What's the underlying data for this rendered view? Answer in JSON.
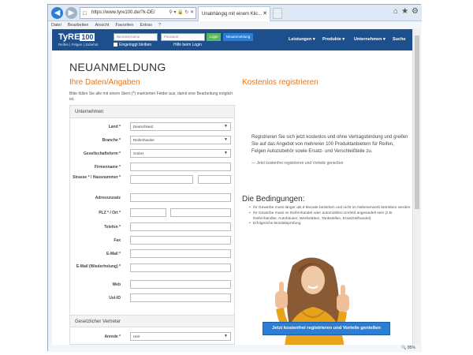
{
  "browser": {
    "url": "https://www.tyre100.de/?k-DE/",
    "tab_title": "Unabhängig mit einem Klic...",
    "menu": [
      "Datei",
      "Bearbeiten",
      "Ansicht",
      "Favoriten",
      "Extras",
      "?"
    ],
    "zoom": "85%"
  },
  "header": {
    "logo": "TyRE",
    "logo_num": "100",
    "tagline": "Reifen | Felgen | Zubehör",
    "user_placeholder": "Benutzername",
    "pass_placeholder": "Passwort",
    "login": "Login",
    "register": "Neuanmeldung",
    "keep_logged": "Eingeloggt bleiben",
    "help": "Hilfe beim Login",
    "nav": [
      "Leistungen ▾",
      "Produkte ▾",
      "Unternehmen ▾",
      "Suche"
    ]
  },
  "page": {
    "title": "NEUANMELDUNG",
    "left_heading": "Ihre Daten/Angaben",
    "right_heading": "Kostenlos registrieren",
    "hint": "Bitte füllen Sie alle mit einem Stern (*) markierten Felder aus, damit eine Bearbeitung möglich ist."
  },
  "form": {
    "section1": "Unternehmen",
    "section2": "Gesetzlicher Vertreter",
    "fields": [
      {
        "label": "Land *",
        "value": "Deutschland"
      },
      {
        "label": "Branche *",
        "value": "Reifenhandel"
      },
      {
        "label": "Gesellschaftsform *",
        "value": "GmbH"
      },
      {
        "label": "Firmenname *",
        "value": ""
      },
      {
        "label": "Strasse * / Hausnummer *",
        "value": ""
      },
      {
        "label": "Adresszusatz",
        "value": ""
      },
      {
        "label": "PLZ * / Ort *",
        "value": ""
      },
      {
        "label": "Telefon *",
        "value": ""
      },
      {
        "label": "Fax",
        "value": ""
      },
      {
        "label": "E-Mail *",
        "value": ""
      },
      {
        "label": "E-Mail (Wiederholung) *",
        "value": ""
      },
      {
        "label": "Web",
        "value": ""
      },
      {
        "label": "Ust-ID",
        "value": ""
      }
    ],
    "anrede_label": "Anrede *",
    "anrede_value": "Herr"
  },
  "right": {
    "text": "Registrieren Sie sich jetzt kostenlos und ohne Vertragsbindung und greifen Sie auf das Angebot von mehreren 100 Produktanbietern für Reifen, Felgen Autozubehör sowie Ersatz- und Verschleißteile zu.",
    "subtext": "— Jetzt kostenfrei registrieren und Vorteile genießen",
    "conditions_title": "Die Bedingungen:",
    "conditions": [
      "Ihr Gewerbe muss länger als 6 Monate bestehen und nicht im Nebenerwerb betrieben werden",
      "Ihr Gewerbe muss im Reifenhandel oder automobilen Umfeld angesiedelt sein (z.B. Reifenhändler, Autohäuser, Werkstätten, Tankstellen, Ersatzteilhandel)",
      "Erfolgreiche Bonitätsprüfung"
    ],
    "cta": "Jetzt kostenfrei registrieren und Vorteile genießen"
  },
  "colors": {
    "brand": "#1d4f8c",
    "accent": "#e8761c",
    "button": "#2a7fd4",
    "login": "#5cb85c"
  }
}
